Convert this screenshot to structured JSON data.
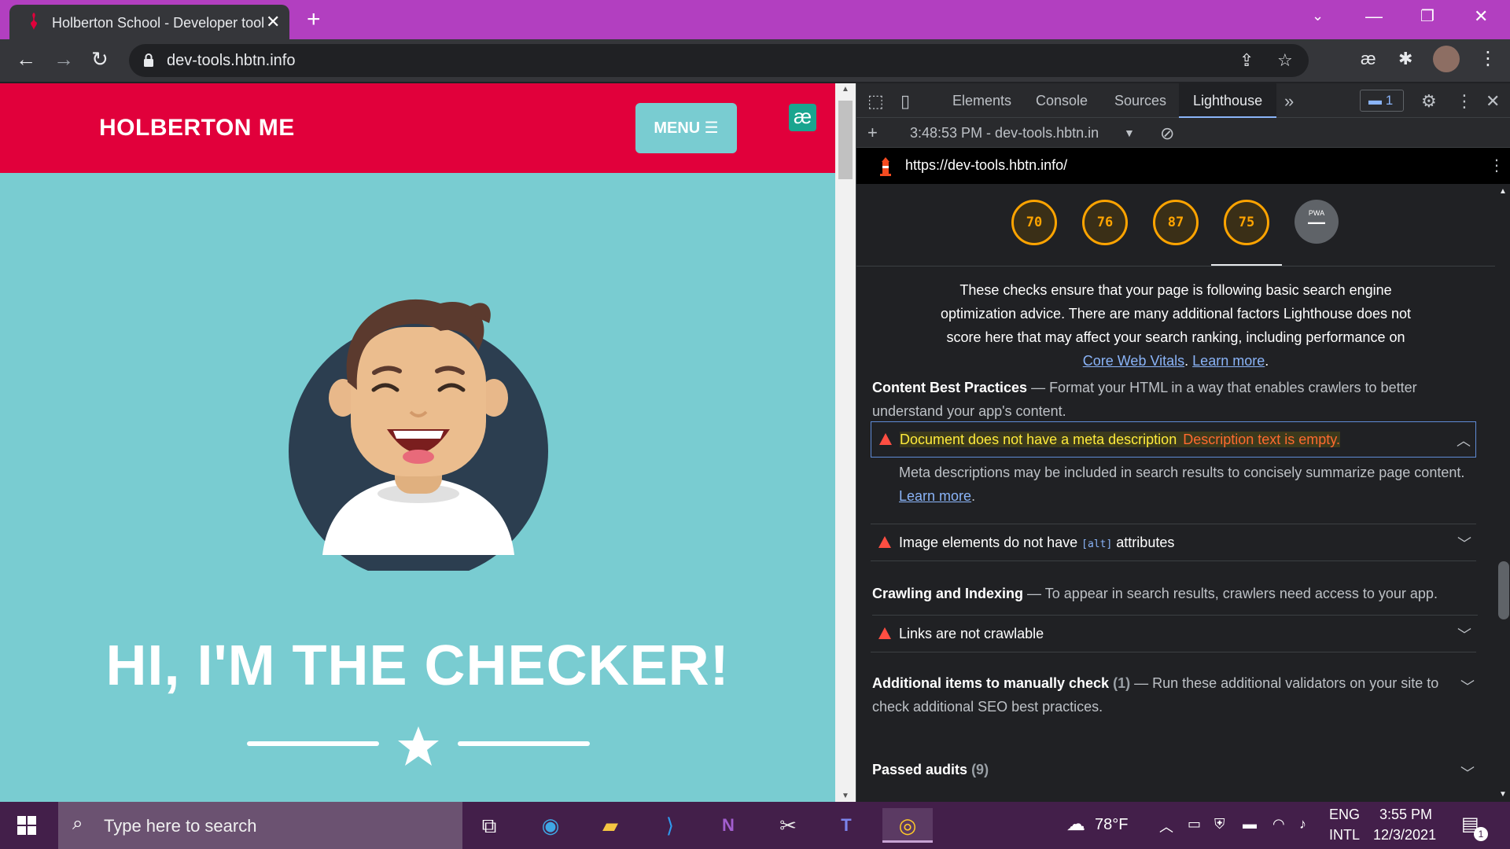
{
  "browser": {
    "tab_title": "Holberton School - Developer tools",
    "new_tab_symbol": "+",
    "url": "dev-tools.hbtn.info",
    "accent": "#b23fc0"
  },
  "site": {
    "logo": "HOLBERTON ME",
    "menu_label": "MENU ☰",
    "ext_badge": "æ",
    "hero_title": "HI, I'M THE CHECKER!",
    "header_color": "#e1003b",
    "bg_color": "#79ccd1"
  },
  "devtools": {
    "tabs": [
      "Elements",
      "Console",
      "Sources",
      "Lighthouse"
    ],
    "active_tab": "Lighthouse",
    "more_tabs": "»",
    "message_count": "1",
    "report_selector": "3:48:53 PM - dev-tools.hbtn.in",
    "report_url": "https://dev-tools.hbtn.info/",
    "scores": [
      "70",
      "76",
      "87",
      "75"
    ],
    "pwa_label": "PWA",
    "intro_text": "These checks ensure that your page is following basic search engine optimization advice. There are many additional factors Lighthouse does not score here that may affect your search ranking, including performance on",
    "intro_link1": "Core Web Vitals",
    "intro_sep": ". ",
    "intro_link2": "Learn more",
    "intro_end": ".",
    "group1_title": "Content Best Practices",
    "group1_desc": " — Format your HTML in a way that enables crawlers to better understand your app's content.",
    "audit1_title": "Document does not have a meta description",
    "audit1_note": "Description text is empty.",
    "audit1_desc": "Meta descriptions may be included in search results to concisely summarize page content.",
    "audit1_link": "Learn more",
    "audit1_end": ".",
    "audit2_title_a": "Image elements do not have ",
    "audit2_code": "[alt]",
    "audit2_title_b": " attributes",
    "group2_title": "Crawling and Indexing",
    "group2_desc": " — To appear in search results, crawlers need access to your app.",
    "audit3_title": "Links are not crawlable",
    "group3_title": "Additional items to manually check",
    "group3_count": " (1)",
    "group3_desc": " — Run these additional validators on your site to check additional SEO best practices.",
    "group4_title": "Passed audits",
    "group4_count": " (9)"
  },
  "taskbar": {
    "search_placeholder": "Type here to search",
    "weather": "78°F",
    "lang1": "ENG",
    "lang2": "INTL",
    "time": "3:55 PM",
    "date": "12/3/2021",
    "notif_count": "1"
  }
}
